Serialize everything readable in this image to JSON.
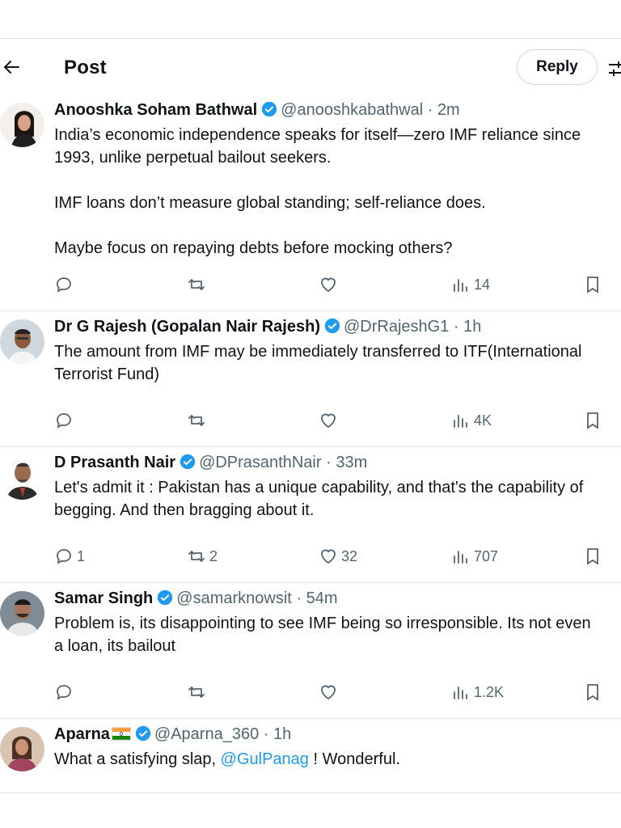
{
  "header": {
    "title": "Post",
    "reply_label": "Reply",
    "back_icon": "arrow-left-icon",
    "settings_icon": "sliders-icon"
  },
  "colors": {
    "accent": "#1d9bf0",
    "text": "#0f1419",
    "muted": "#536471",
    "divider": "#e6e6e6"
  },
  "replies": [
    {
      "name": "Anooshka Soham Bathwal",
      "handle": "@anooshkabathwal",
      "sep": "·",
      "time": "2m",
      "verified": true,
      "lines": [
        "India’s economic independence speaks for itself—zero IMF reliance since",
        "1993, unlike perpetual bailout seekers."
      ],
      "lines2": [
        "IMF loans don’t measure global standing; self-reliance does."
      ],
      "lines3": [
        "Maybe focus on repaying debts before mocking others?"
      ],
      "stats": {
        "replies": "",
        "reposts": "",
        "likes": "",
        "views": "14"
      }
    },
    {
      "name": "Dr G Rajesh (Gopalan Nair Rajesh)",
      "handle": "@DrRajeshG1",
      "sep": "·",
      "time": "1h",
      "verified": true,
      "lines": [
        "The amount from IMF may be immediately transferred to ITF(International",
        "Terrorist Fund)"
      ],
      "stats": {
        "replies": "",
        "reposts": "",
        "likes": "",
        "views": "4K"
      }
    },
    {
      "name": "D Prasanth Nair",
      "handle": "@DPrasanthNair",
      "sep": "·",
      "time": "33m",
      "verified": true,
      "lines": [
        "Let's admit it : Pakistan has a unique capability, and that's the capability of",
        "begging. And then bragging about it."
      ],
      "stats": {
        "replies": "1",
        "reposts": "2",
        "likes": "32",
        "views": "707"
      }
    },
    {
      "name": "Samar Singh",
      "handle": "@samarknowsit",
      "sep": "·",
      "time": "54m",
      "verified": true,
      "lines": [
        "Problem is, its disappointing to see IMF being so irresponsible. Its not even",
        "a loan, its bailout"
      ],
      "stats": {
        "replies": "",
        "reposts": "",
        "likes": "",
        "views": "1.2K"
      }
    },
    {
      "name": "Aparna",
      "handle": "@Aparna_360",
      "sep": "·",
      "time": "1h",
      "verified": true,
      "flag": "india-flag-icon",
      "text_before": "What a satisfying slap, ",
      "mention": "@GulPanag",
      "text_after": " ! Wonderful."
    }
  ]
}
